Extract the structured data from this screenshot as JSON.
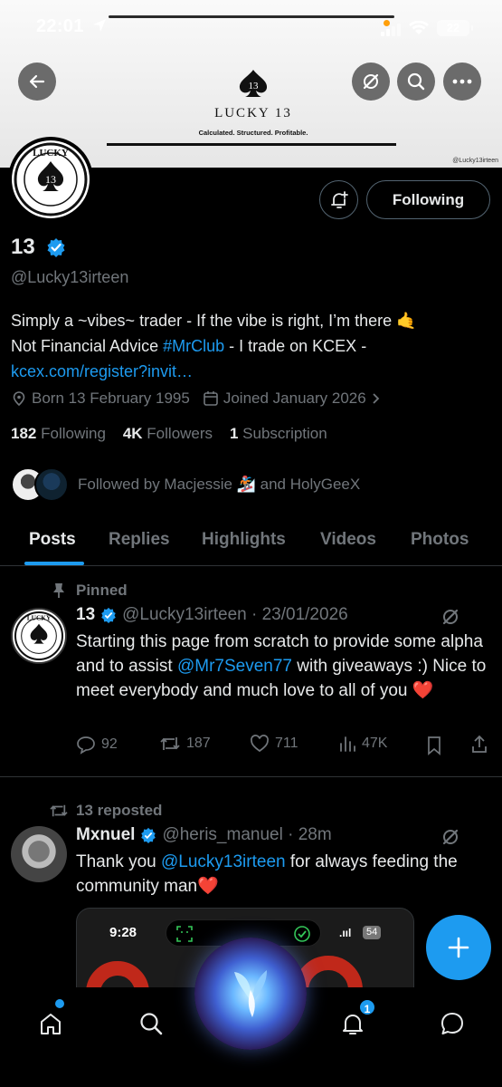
{
  "status_bar": {
    "time": "22:01",
    "battery": "22"
  },
  "banner": {
    "brand": "LUCKY 13",
    "tagline": "Calculated. Structured. Profitable.",
    "watermark": "@Lucky13irteen",
    "spade_number": "13"
  },
  "profile": {
    "name": "13",
    "handle": "@Lucky13irteen",
    "follow_label": "Following",
    "bio_line1": "Simply a ~vibes~ trader - If the vibe is right, I’m there 🤙",
    "bio_line2_a": "Not Financial Advice ",
    "bio_line2_hashtag": "#MrClub",
    "bio_line2_b": " - I trade on KCEX -",
    "bio_link": "kcex.com/register?invit…",
    "born": "Born 13 February 1995",
    "joined": "Joined January 2026",
    "following_count": "182",
    "following_label": "Following",
    "followers_count": "4K",
    "followers_label": "Followers",
    "subscription_count": "1",
    "subscription_label": "Subscription",
    "followed_by": "Followed by Macjessie 🏂 and HolyGeeX"
  },
  "tabs": [
    "Posts",
    "Replies",
    "Highlights",
    "Videos",
    "Photos"
  ],
  "pinned_post": {
    "pinned_label": "Pinned",
    "author": "13",
    "handle_date": "@Lucky13irteen · 23/01/2026",
    "text_a": "Starting this page from scratch to provide some alpha and to assist ",
    "mention": "@Mr7Seven77",
    "text_b": " with giveaways :) Nice to meet everybody and much love to all of you ❤️",
    "replies": "92",
    "reposts": "187",
    "likes": "711",
    "views": "47K"
  },
  "repost": {
    "repost_label": "13 reposted",
    "author": "Mxnuel",
    "handle_time": "@heris_manuel · 28m",
    "text_a": "Thank you ",
    "mention": "@Lucky13irteen",
    "text_b": " for always feeding the community man❤️",
    "media_time": "9:28",
    "media_battery": "54"
  },
  "nav": {
    "notification_badge": "1"
  },
  "colors": {
    "accent": "#1d9bf0",
    "background": "#000000",
    "muted": "#71767b"
  }
}
